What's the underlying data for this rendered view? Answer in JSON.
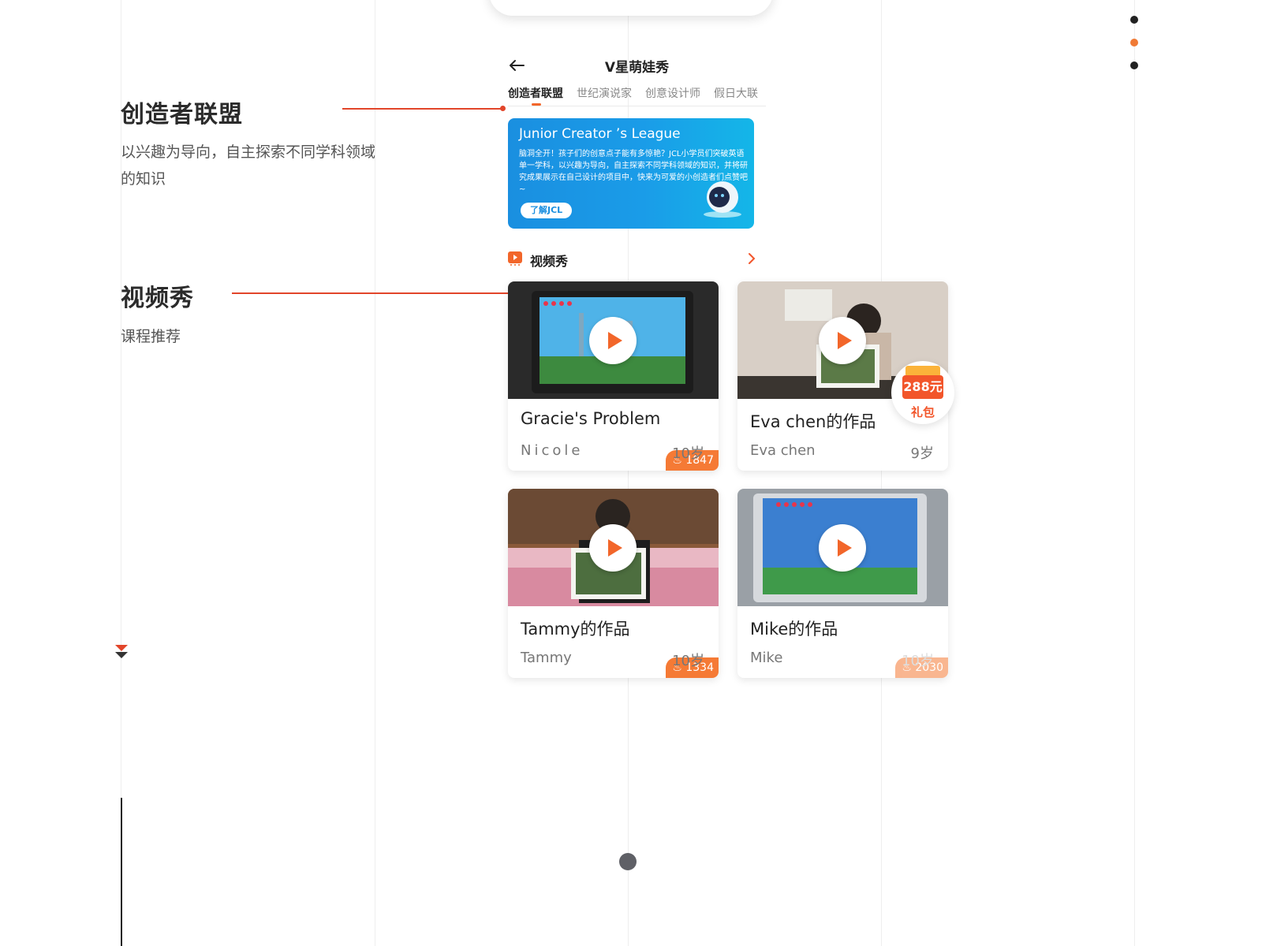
{
  "colors": {
    "accent": "#e2452a",
    "orange": "#f2662a",
    "nav_dot_active": "#f07a35",
    "nav_dot": "#222222",
    "banner_blue": "#1a8fe0"
  },
  "annotations": [
    {
      "title": "创造者联盟",
      "desc": "以兴趣为导向，自主探索不同学科领域的知识"
    },
    {
      "title": "视频秀",
      "desc": "课程推荐"
    }
  ],
  "app": {
    "title": "V星萌娃秀",
    "back_icon": "arrow-left-icon",
    "tabs": [
      {
        "label": "创造者联盟",
        "active": true
      },
      {
        "label": "世纪演说家",
        "active": false
      },
      {
        "label": "创意设计师",
        "active": false
      },
      {
        "label": "假日大联",
        "active": false
      }
    ],
    "banner": {
      "title": "Junior Creator ’s League",
      "text": "脑洞全开！孩子们的创意点子能有多惊艳？JCL小学员们突破英语单一学科，以兴趣为导向，自主探索不同学科领域的知识，并将研究成果展示在自己设计的项目中，快来为可爱的小创造者们点赞吧~",
      "button": "了解JCL"
    },
    "section": {
      "title": "视频秀",
      "icon": "video-play-icon",
      "more_icon": "chevron-right-icon"
    },
    "cards": [
      {
        "title": "Gracie's Problem",
        "author": "Nicole",
        "age": "10岁",
        "views": "1847"
      },
      {
        "title": "Eva chen的作品",
        "author": "Eva chen",
        "age": "9岁",
        "views": ""
      },
      {
        "title": "Tammy的作品",
        "author": "Tammy",
        "age": "10岁",
        "views": "1334"
      },
      {
        "title": "Mike的作品",
        "author": "Mike",
        "age": "10岁",
        "views": "2030"
      }
    ],
    "gift": {
      "amount": "288元",
      "label": "礼包"
    }
  }
}
